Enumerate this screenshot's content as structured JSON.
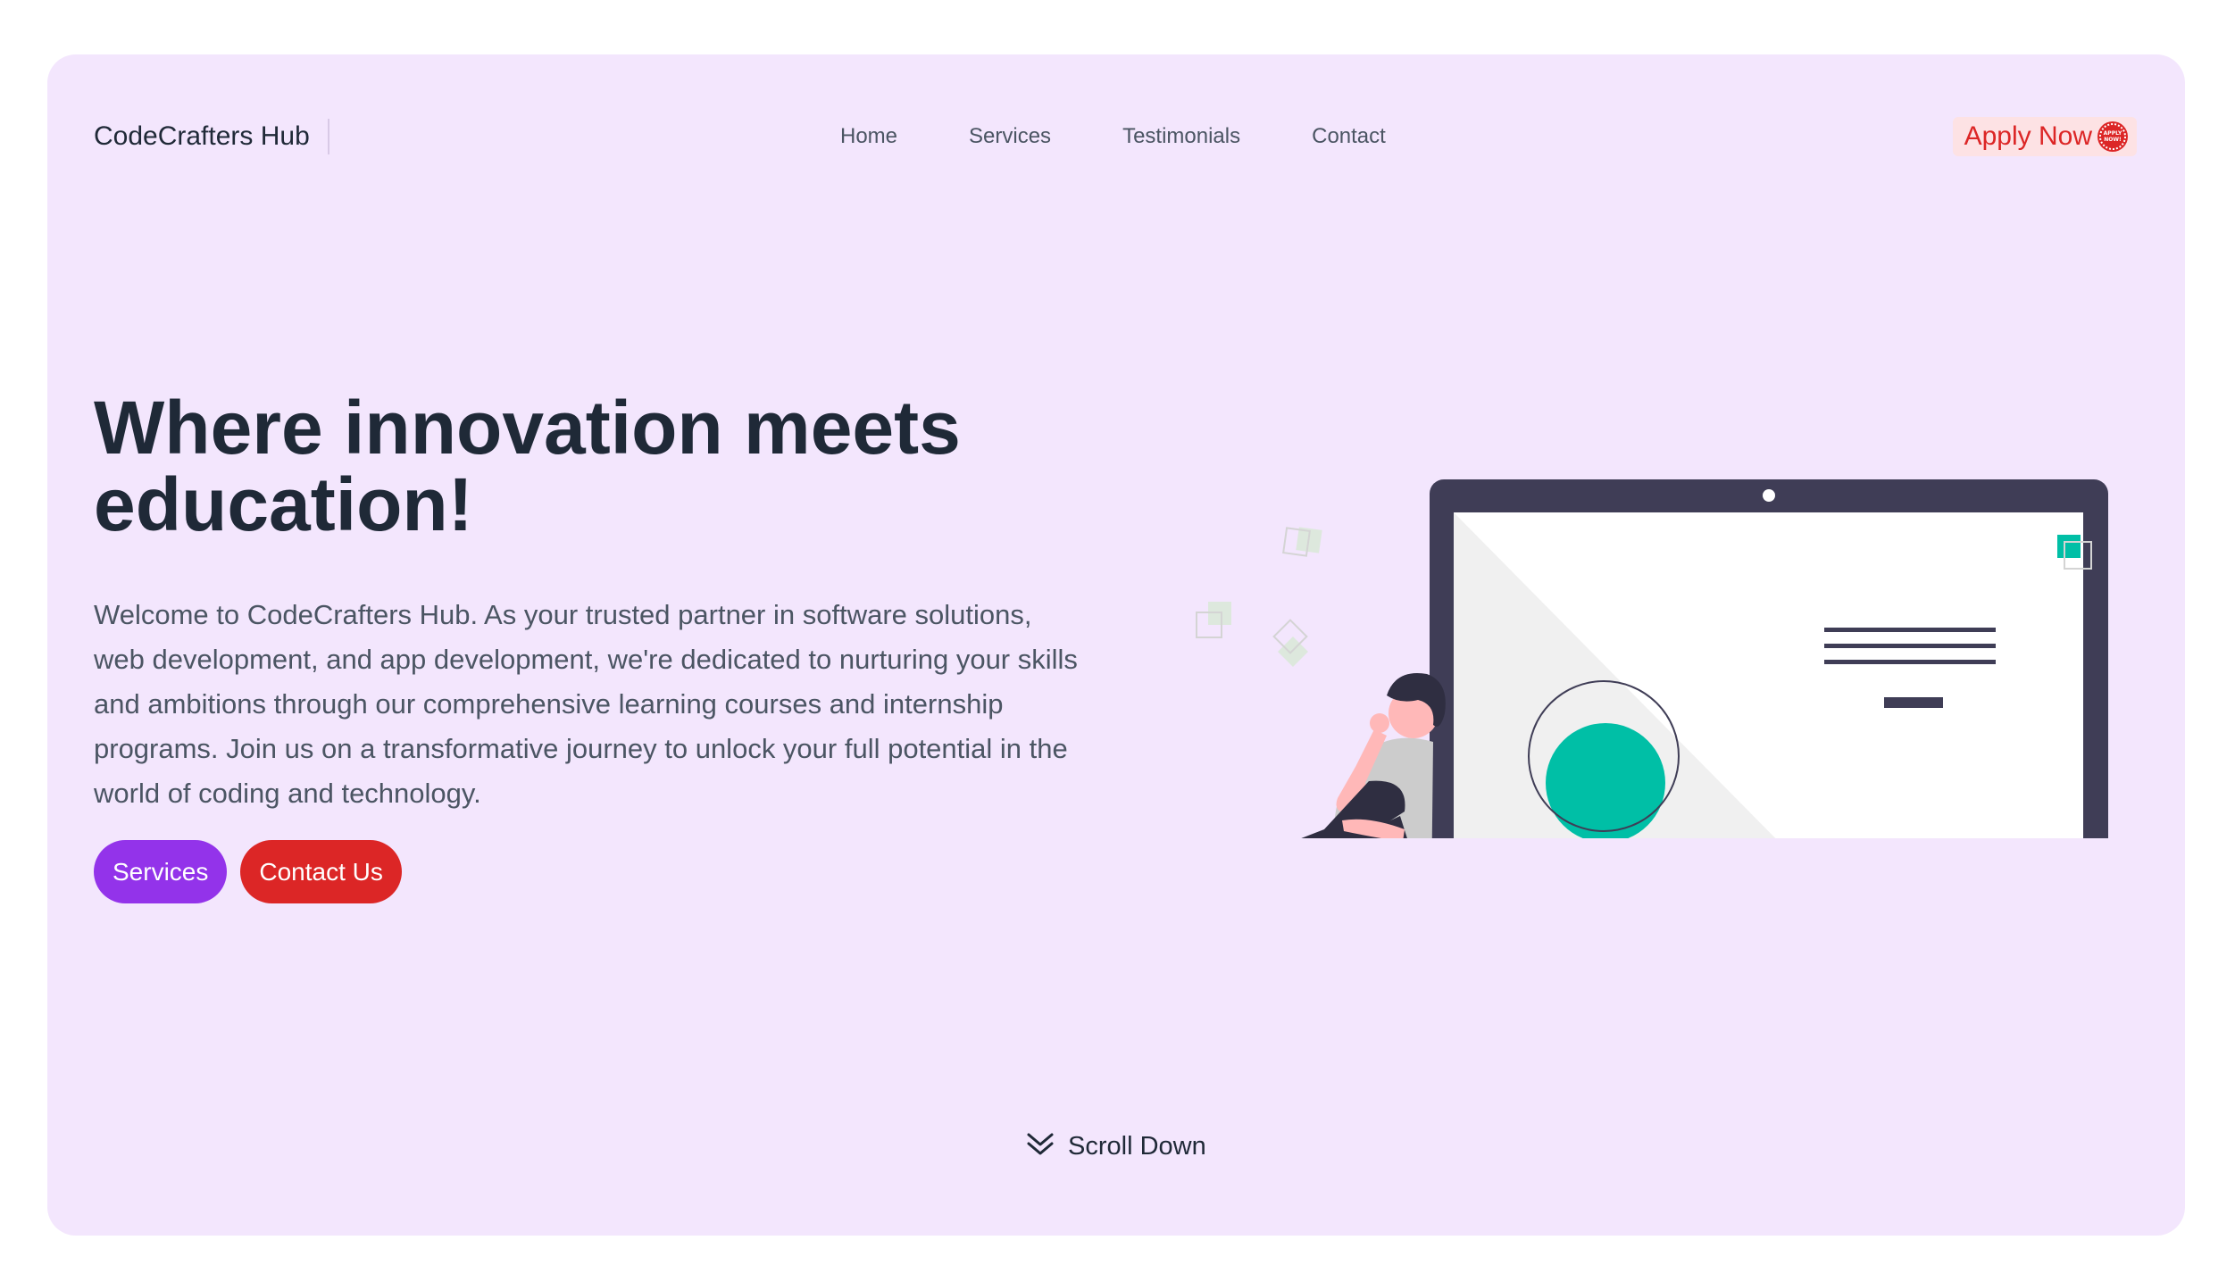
{
  "brand": {
    "name": "CodeCrafters Hub"
  },
  "nav": {
    "items": [
      {
        "label": "Home"
      },
      {
        "label": "Services"
      },
      {
        "label": "Testimonials"
      },
      {
        "label": "Contact"
      }
    ],
    "apply_label": "Apply Now",
    "apply_badge_text": "APPLY NOW!"
  },
  "hero": {
    "title": "Where innovation meets education!",
    "description": "Welcome to CodeCrafters Hub. As your trusted partner in software solutions, web development, and app development, we're dedicated to nurturing your skills and ambitions through our comprehensive learning courses and internship programs. Join us on a transformative journey to unlock your full potential in the world of coding and technology.",
    "buttons": {
      "services": "Services",
      "contact": "Contact Us"
    }
  },
  "scroll": {
    "label": "Scroll Down",
    "icon": "double-chevron-down-icon"
  },
  "colors": {
    "background": "#f3e6fd",
    "primary_purple": "#9333ea",
    "primary_red": "#dc2626",
    "text_dark": "#1f2937",
    "text_muted": "#4b5563",
    "laptop": "#3f3d56",
    "accent_teal": "#00bfa6"
  }
}
